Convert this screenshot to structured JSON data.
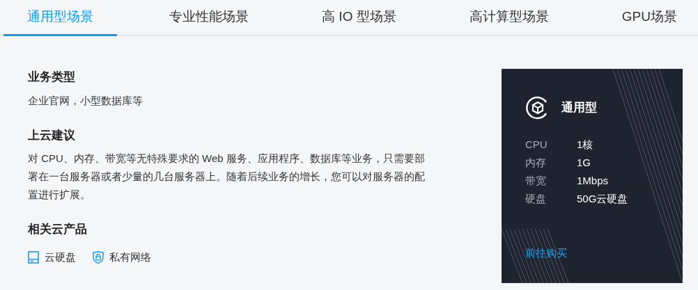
{
  "tabs": [
    {
      "label": "通用型场景",
      "selected": true
    },
    {
      "label": "专业性能场景",
      "selected": false
    },
    {
      "label": "高 IO 型场景",
      "selected": false
    },
    {
      "label": "高计算型场景",
      "selected": false
    },
    {
      "label": "GPU场景",
      "selected": false
    }
  ],
  "sections": [
    {
      "heading": "业务类型",
      "text": "企业官网，小型数据库等"
    },
    {
      "heading": "上云建议",
      "text": "对 CPU、内存、带宽等无特殊要求的  Web 服务、应用程序、数据库等业务，只需要部署在一台服务器或者少量的几台服务器上。随着后续业务的增长，您可以对服务器的配置进行扩展。"
    }
  ],
  "products": {
    "heading": "相关云产品",
    "items": [
      {
        "kind": "disk",
        "label": "云硬盘"
      },
      {
        "kind": "network",
        "label": "私有网络"
      }
    ]
  },
  "spec_card": {
    "title": "通用型",
    "specs": [
      {
        "label": "CPU",
        "value": "1核"
      },
      {
        "label": "内存",
        "value": "1G"
      },
      {
        "label": "带宽",
        "value": "1Mbps"
      },
      {
        "label": "硬盘",
        "value": "50G云硬盘"
      }
    ],
    "link": "前往购买"
  }
}
